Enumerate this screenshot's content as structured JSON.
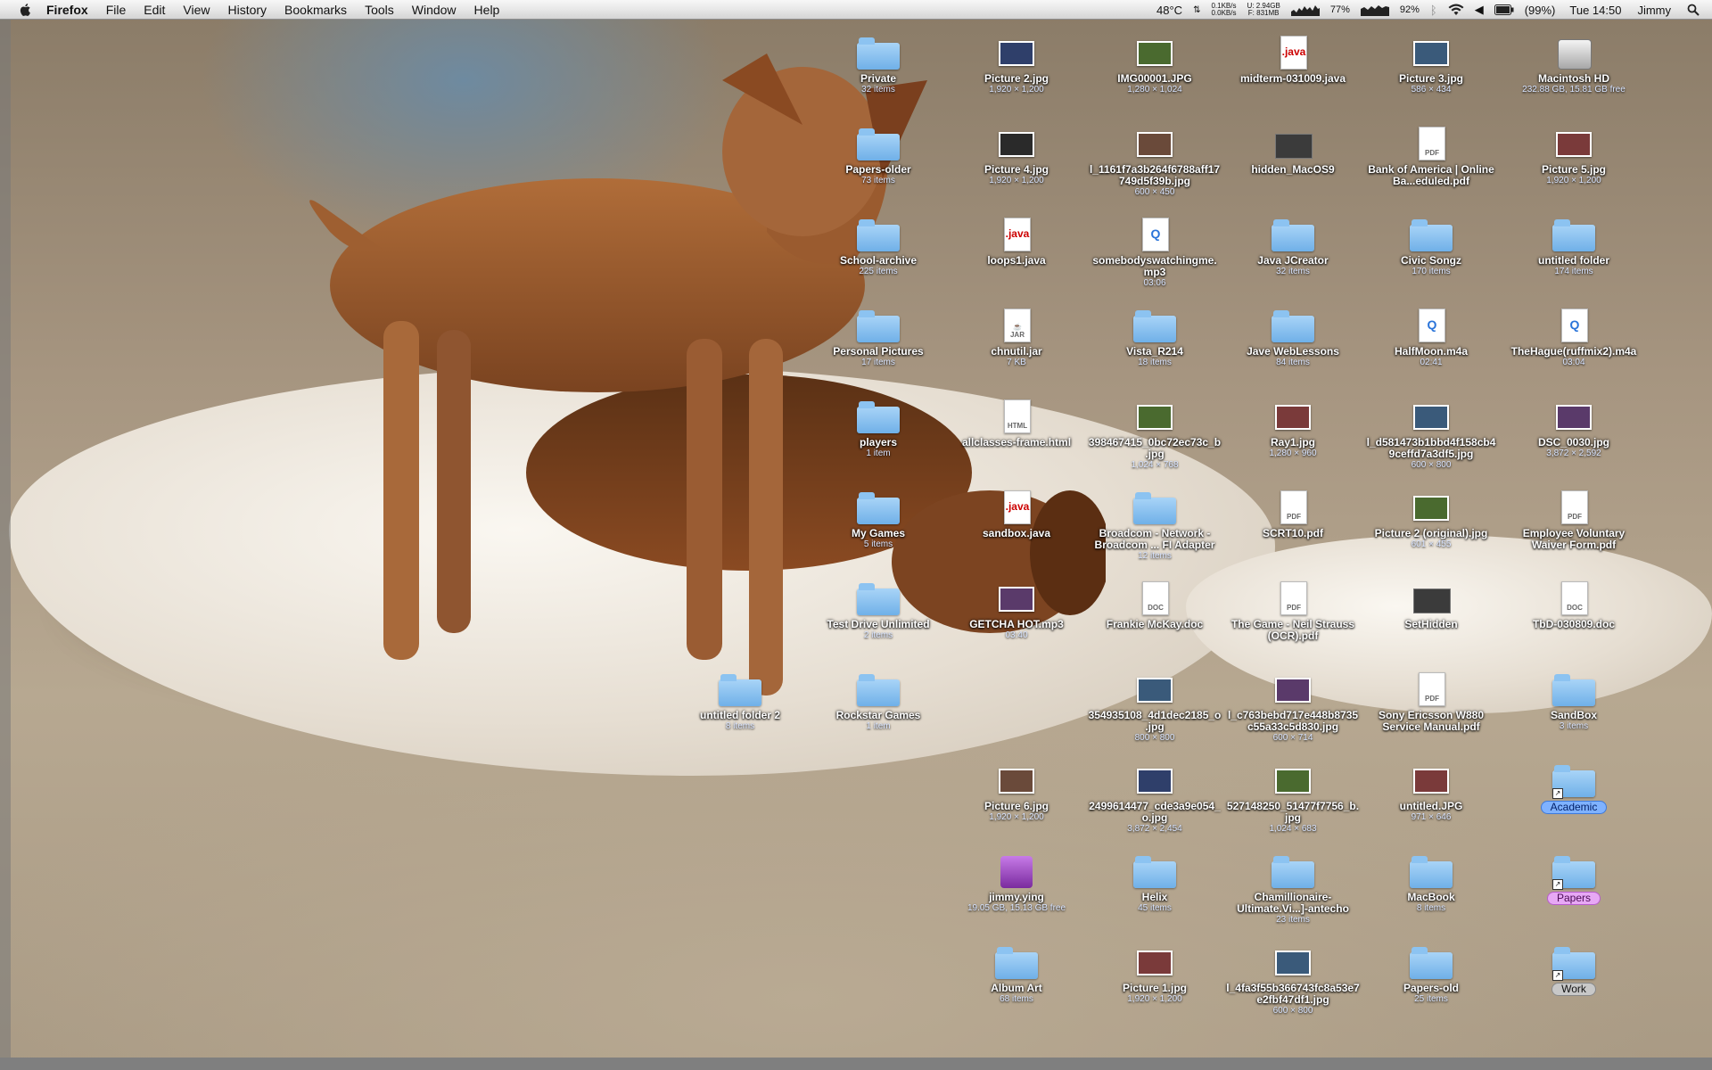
{
  "menubar": {
    "app_name": "Firefox",
    "menus": [
      "File",
      "Edit",
      "View",
      "History",
      "Bookmarks",
      "Tools",
      "Window",
      "Help"
    ],
    "temp": "48°C",
    "net_up": "0.1KB/s",
    "net_down": "0.0KB/s",
    "disk_u": "U: 2.94GB",
    "disk_f": "F: 831MB",
    "cpu_percent": "77%",
    "mem_percent": "92%",
    "battery": "(99%)",
    "clock": "Tue 14:50",
    "user": "Jimmy"
  },
  "icons": [
    {
      "label": "Private",
      "sub": "32 items",
      "type": "folder"
    },
    {
      "label": "Picture 2.jpg",
      "sub": "1,920 × 1,200",
      "type": "image"
    },
    {
      "label": "IMG00001.JPG",
      "sub": "1,280 × 1,024",
      "type": "image"
    },
    {
      "label": "midterm-031009.java",
      "sub": "",
      "type": "java"
    },
    {
      "label": "Picture 3.jpg",
      "sub": "586 × 434",
      "type": "image"
    },
    {
      "label": "Macintosh HD",
      "sub": "232.88 GB, 15.81 GB free",
      "type": "drive"
    },
    {
      "label": "Papers-older",
      "sub": "73 items",
      "type": "folder"
    },
    {
      "label": "Picture 4.jpg",
      "sub": "1,920 × 1,200",
      "type": "image"
    },
    {
      "label": "l_1161f7a3b264f6788aff17749d5f39b.jpg",
      "sub": "600 × 450",
      "type": "image"
    },
    {
      "label": "hidden_MacOS9",
      "sub": "",
      "type": "dark"
    },
    {
      "label": "Bank of America | Online Ba...eduled.pdf",
      "sub": "",
      "type": "pdf"
    },
    {
      "label": "Picture 5.jpg",
      "sub": "1,920 × 1,200",
      "type": "image"
    },
    {
      "label": "School-archive",
      "sub": "225 items",
      "type": "folder"
    },
    {
      "label": "loops1.java",
      "sub": "",
      "type": "java"
    },
    {
      "label": "somebodyswatchingme.mp3",
      "sub": "03:06",
      "type": "media"
    },
    {
      "label": "Java JCreator",
      "sub": "32 items",
      "type": "folder"
    },
    {
      "label": "Civic Songz",
      "sub": "170 items",
      "type": "folder"
    },
    {
      "label": "untitled folder",
      "sub": "174 items",
      "type": "folder"
    },
    {
      "label": "Personal Pictures",
      "sub": "17 items",
      "type": "folder"
    },
    {
      "label": "chnutil.jar",
      "sub": "7 KB",
      "type": "jar"
    },
    {
      "label": "Vista_R214",
      "sub": "18 items",
      "type": "folder"
    },
    {
      "label": "Jave WebLessons",
      "sub": "84 items",
      "type": "folder"
    },
    {
      "label": "HalfMoon.m4a",
      "sub": "02:41",
      "type": "media"
    },
    {
      "label": "TheHague(ruffmix2).m4a",
      "sub": "03:04",
      "type": "media"
    },
    {
      "label": "players",
      "sub": "1 item",
      "type": "folder"
    },
    {
      "label": "allclasses-frame.html",
      "sub": "",
      "type": "html"
    },
    {
      "label": "398467415_0bc72ec73c_b.jpg",
      "sub": "1,024 × 768",
      "type": "image"
    },
    {
      "label": "Ray1.jpg",
      "sub": "1,280 × 960",
      "type": "image"
    },
    {
      "label": "l_d581473b1bbd4f158cb49ceffd7a3df5.jpg",
      "sub": "600 × 800",
      "type": "image"
    },
    {
      "label": "DSC_0030.jpg",
      "sub": "3,872 × 2,592",
      "type": "image"
    },
    {
      "label": "My Games",
      "sub": "5 items",
      "type": "folder"
    },
    {
      "label": "sandbox.java",
      "sub": "",
      "type": "java"
    },
    {
      "label": "Broadcom - Network - Broadcom ... FI Adapter",
      "sub": "12 items",
      "type": "folder"
    },
    {
      "label": "SCRT10.pdf",
      "sub": "",
      "type": "pdf"
    },
    {
      "label": "Picture 2 (original).jpg",
      "sub": "601 × 455",
      "type": "image"
    },
    {
      "label": "Employee Voluntary Waiver Form.pdf",
      "sub": "",
      "type": "pdf"
    },
    {
      "label": "Test Drive Unlimited",
      "sub": "2 items",
      "type": "folder"
    },
    {
      "label": "GETCHA HOT.mp3",
      "sub": "03:40",
      "type": "image"
    },
    {
      "label": "Frankie McKay.doc",
      "sub": "",
      "type": "doc"
    },
    {
      "label": "The Game - Neil Strauss (OCR).pdf",
      "sub": "",
      "type": "pdf"
    },
    {
      "label": "SetHidden",
      "sub": "",
      "type": "dark"
    },
    {
      "label": "TbD-030809.doc",
      "sub": "",
      "type": "doc"
    },
    {
      "label": "untitled folder 2",
      "sub": "8 items",
      "type": "folder"
    },
    {
      "label": "Rockstar Games",
      "sub": "1 item",
      "type": "folder"
    },
    {
      "label": "354935108_4d1dec2185_o.jpg",
      "sub": "800 × 800",
      "type": "image"
    },
    {
      "label": "l_c763bebd717e448b8735c55a33c5d830.jpg",
      "sub": "600 × 714",
      "type": "image"
    },
    {
      "label": "Sony Ericsson W880 Service Manual.pdf",
      "sub": "",
      "type": "pdf"
    },
    {
      "label": "SandBox",
      "sub": "3 items",
      "type": "folder"
    },
    {
      "label": "Picture 6.jpg",
      "sub": "1,920 × 1,200",
      "type": "image"
    },
    {
      "label": "2499614477_cde3a9e054_o.jpg",
      "sub": "3,872 × 2,454",
      "type": "image"
    },
    {
      "label": "527148250_51477f7756_b.jpg",
      "sub": "1,024 × 683",
      "type": "image"
    },
    {
      "label": "untitled.JPG",
      "sub": "971 × 646",
      "type": "image"
    },
    {
      "label": "Academic",
      "sub": "",
      "type": "alias",
      "tag": "blue"
    },
    {
      "label": "jimmy.ying",
      "sub": "19.05 GB, 15.13 GB free",
      "type": "purple"
    },
    {
      "label": "Helix",
      "sub": "45 items",
      "type": "folder"
    },
    {
      "label": "Chamillionaire-Ultimate.Vi...]-antecho",
      "sub": "23 items",
      "type": "folder"
    },
    {
      "label": "MacBook",
      "sub": "8 items",
      "type": "folder"
    },
    {
      "label": "Papers",
      "sub": "",
      "type": "alias",
      "tag": "pink"
    },
    {
      "label": "Album Art",
      "sub": "68 items",
      "type": "folder"
    },
    {
      "label": "Picture 1.jpg",
      "sub": "1,920 × 1,200",
      "type": "image"
    },
    {
      "label": "l_4fa3f55b366743fc8a53e7e2fbf47df1.jpg",
      "sub": "600 × 800",
      "type": "image"
    },
    {
      "label": "Papers-old",
      "sub": "25 items",
      "type": "folder"
    },
    {
      "label": "Work",
      "sub": "",
      "type": "alias",
      "tag": "gray"
    }
  ]
}
